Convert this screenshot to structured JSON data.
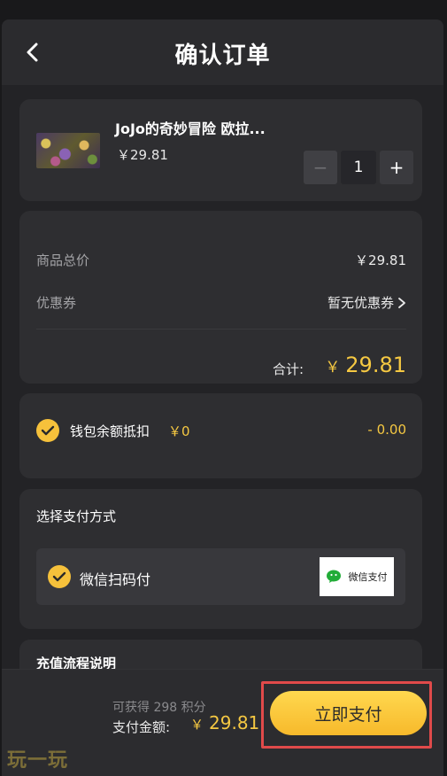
{
  "header": {
    "title": "确认订单",
    "back_icon": "chevron-left-icon"
  },
  "product": {
    "name": "JoJo的奇妙冒险 欧拉...",
    "price": "￥29.81",
    "quantity": "1",
    "decrement_label": "−",
    "increment_label": "+"
  },
  "summary": {
    "goods_total_label": "商品总价",
    "goods_total_value": "￥29.81",
    "coupon_label": "优惠券",
    "coupon_value": "暂无优惠券",
    "total_label": "合计:",
    "total_currency": "￥",
    "total_value": "29.81"
  },
  "wallet": {
    "label": "钱包余额抵扣",
    "balance": "￥0",
    "deduction": "- 0.00",
    "checked": true
  },
  "payment": {
    "section_title": "选择支付方式",
    "method_label": "微信扫码付",
    "logo_text": "微信支付",
    "checked": true
  },
  "recharge": {
    "title": "充值流程说明"
  },
  "footer": {
    "points_text": "可获得 298 积分",
    "pay_total_label": "支付金额:",
    "pay_total_currency": "￥",
    "pay_total_value": "29.81",
    "pay_button_label": "立即支付"
  },
  "watermark": "玩一玩",
  "colors": {
    "accent": "#f5c842",
    "button_gradient_top": "#ffd84f",
    "button_gradient_bottom": "#f7b92b",
    "highlight_border": "#e04a4a",
    "wechat_green": "#22ac38"
  }
}
